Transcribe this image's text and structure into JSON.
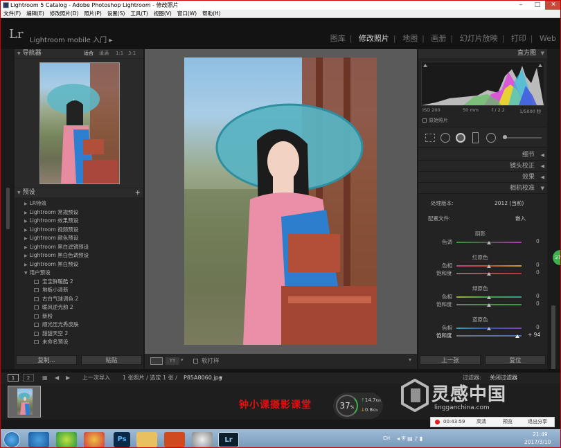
{
  "window": {
    "title": "Lightroom 5 Catalog - Adobe Photoshop Lightroom - 修改照片"
  },
  "menu": [
    "文件(F)",
    "编辑(E)",
    "修改照片(D)",
    "照片(P)",
    "设置(S)",
    "工具(T)",
    "视图(V)",
    "窗口(W)",
    "帮助(H)"
  ],
  "header": {
    "logo": "Lr",
    "mobile_label": "Lightroom mobile 入门",
    "mobile_arrow": "▸",
    "modules": [
      "图库",
      "修改照片",
      "地图",
      "画册",
      "幻灯片放映",
      "打印",
      "Web"
    ],
    "active_module": "修改照片"
  },
  "left_panel": {
    "navigator": {
      "title": "导航器",
      "zoom_options": [
        "适合",
        "填满",
        "1:1",
        "3:1"
      ]
    },
    "presets": {
      "title": "预设",
      "add": "+",
      "folders": [
        "LR特效",
        "Lightroom 常规预设",
        "Lightroom 效果预设",
        "Lightroom 视频预设",
        "Lightroom 颜色预设",
        "Lightroom 黑白滤镜预设",
        "Lightroom 黑白色调预设",
        "Lightroom 黑白预设"
      ],
      "user_folder": "用户预设",
      "user_presets": [
        "宝宝鲜暖酷 2",
        "地板小清新",
        "古白气球调色 2",
        "暖风逆光韵 2",
        "新粉",
        "顺光压光秀皮肤",
        "甜甜天空 2",
        "未命名预设"
      ]
    },
    "buttons": {
      "copy": "复制...",
      "paste": "粘贴"
    }
  },
  "center": {
    "toolbar": {
      "view_label": "YY",
      "softproof": "软打样"
    }
  },
  "right_panel": {
    "histogram": {
      "title": "直方图",
      "iso": "ISO 200",
      "focal": "50 mm",
      "aperture": "f / 2.2",
      "shutter": "1/5000 秒",
      "original_photo": "原始照片"
    },
    "sections": [
      "细节",
      "镜头校正",
      "效果",
      "相机校准"
    ],
    "calibration": {
      "process_label": "处理版本:",
      "process_value": "2012 (当前)",
      "profile_label": "配置文件:",
      "profile_value": "嵌入",
      "shadow_group": "阴影",
      "shadow_tint_label": "色调",
      "shadow_tint_value": "0",
      "red_group": "红原色",
      "red_hue_label": "色相",
      "red_hue_value": "0",
      "red_sat_label": "饱和度",
      "red_sat_value": "0",
      "green_group": "绿原色",
      "green_hue_label": "色相",
      "green_hue_value": "0",
      "green_sat_label": "饱和度",
      "green_sat_value": "0",
      "blue_group": "蓝原色",
      "blue_hue_label": "色相",
      "blue_hue_value": "0",
      "blue_sat_label": "饱和度",
      "blue_sat_value": "+ 94"
    },
    "buttons": {
      "previous": "上一张",
      "reset": "复位"
    }
  },
  "filmstrip_bar": {
    "page1": "1",
    "page2": "2",
    "source": "上一次导入",
    "count": "1 张照片 / 选定 1 张 /",
    "filename": "P85A8060.jpg",
    "filename_arrow": "▾",
    "filter_label": "过滤器:",
    "filter_value": "关闭过滤器"
  },
  "overlay": {
    "caption": "钟小课摄影课堂",
    "cpu_percent": "37",
    "cpu_unit": "%",
    "net_up": "14.7",
    "net_up_unit": "K/s",
    "net_down": "0.8",
    "net_down_unit": "K/s",
    "watermark_name": "灵感中国",
    "watermark_url": "lingganchina.com",
    "recorder_time": "00:43:59",
    "recorder_quality": "高清",
    "recorder_preview": "预览",
    "recorder_exit": "退出分享",
    "side_badge": "37"
  },
  "taskbar": {
    "lang": "CH",
    "time": "21:49",
    "date": "2017/3/10",
    "ps_label": "Ps",
    "lr_label": "Lr"
  },
  "colors": {
    "active_module": "#dddddd",
    "caption_red": "#e01010",
    "recorder_dot": "#e02020",
    "slider_blue_sat": "#4a70c8"
  }
}
